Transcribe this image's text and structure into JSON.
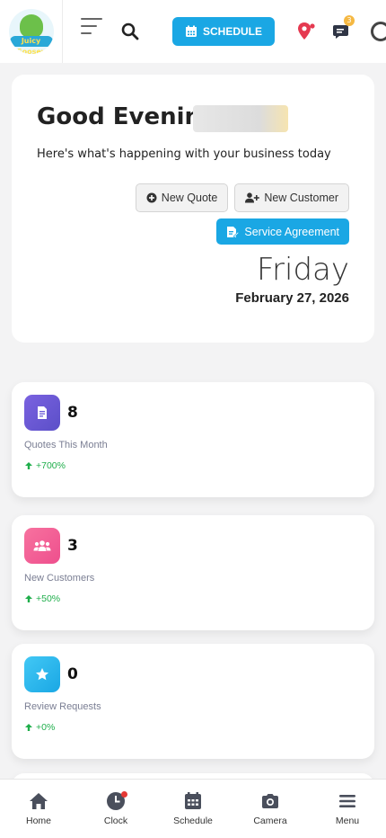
{
  "header": {
    "logo_text": "Juicy Goosey",
    "schedule_label": "SCHEDULE",
    "messages_badge": "3",
    "brand_color": "#1aa7e4"
  },
  "greeting": {
    "title": "Good Evening,",
    "subtitle": "Here's what's happening with your business today",
    "new_quote_label": "New Quote",
    "new_customer_label": "New Customer",
    "service_agreement_label": "Service Agreement",
    "day": "Friday",
    "date": "February 27, 2026"
  },
  "stats": [
    {
      "value": "8",
      "label": "Quotes This Month",
      "change": "+700%",
      "icon": "document-icon",
      "color": "#6a5ad8"
    },
    {
      "value": "3",
      "label": "New Customers",
      "change": "+50%",
      "icon": "users-icon",
      "color": "#f0609a"
    },
    {
      "value": "0",
      "label": "Review Requests",
      "change": "+0%",
      "icon": "star-icon",
      "color": "#2bb8f2"
    }
  ],
  "bottom_nav": [
    {
      "label": "Home",
      "icon": "home-icon"
    },
    {
      "label": "Clock",
      "icon": "clock-icon"
    },
    {
      "label": "Schedule",
      "icon": "calendar-icon"
    },
    {
      "label": "Camera",
      "icon": "camera-icon"
    },
    {
      "label": "Menu",
      "icon": "menu-icon"
    }
  ]
}
